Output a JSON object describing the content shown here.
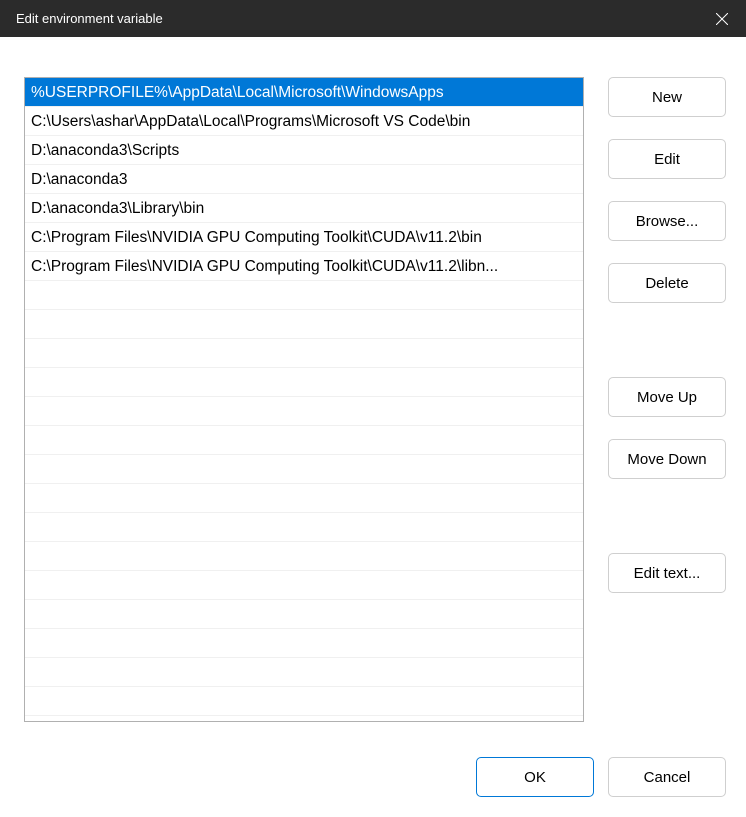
{
  "titlebar": {
    "title": "Edit environment variable"
  },
  "paths": [
    "%USERPROFILE%\\AppData\\Local\\Microsoft\\WindowsApps",
    "C:\\Users\\ashar\\AppData\\Local\\Programs\\Microsoft VS Code\\bin",
    "D:\\anaconda3\\Scripts",
    "D:\\anaconda3",
    "D:\\anaconda3\\Library\\bin",
    "C:\\Program Files\\NVIDIA GPU Computing Toolkit\\CUDA\\v11.2\\bin",
    "C:\\Program Files\\NVIDIA GPU Computing Toolkit\\CUDA\\v11.2\\libn..."
  ],
  "selected_index": 0,
  "buttons": {
    "new": "New",
    "edit": "Edit",
    "browse": "Browse...",
    "delete": "Delete",
    "move_up": "Move Up",
    "move_down": "Move Down",
    "edit_text": "Edit text...",
    "ok": "OK",
    "cancel": "Cancel"
  }
}
